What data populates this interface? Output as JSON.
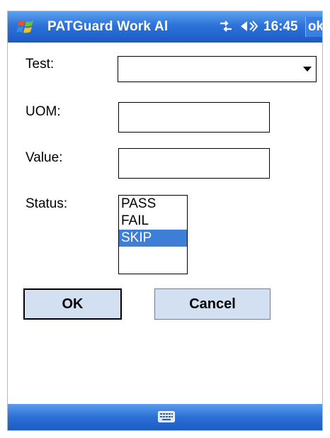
{
  "titlebar": {
    "title": "PATGuard Work Al",
    "time": "16:45",
    "ok_label": "ok",
    "icons": [
      "windows-start-icon",
      "connectivity-icon",
      "volume-icon"
    ]
  },
  "form": {
    "test_label": "Test:",
    "test_value": "",
    "uom_label": "UOM:",
    "uom_value": "",
    "value_label": "Value:",
    "value_value": "",
    "status_label": "Status:",
    "status_options": [
      "PASS",
      "FAIL",
      "SKIP"
    ],
    "status_selected": "SKIP"
  },
  "buttons": {
    "ok_label": "OK",
    "cancel_label": "Cancel"
  },
  "bottombar": {
    "icon": "keyboard-icon"
  },
  "colors": {
    "titlebar": "#2d73d8",
    "selection": "#3d7fd6",
    "button_face": "#d2e0f1"
  }
}
